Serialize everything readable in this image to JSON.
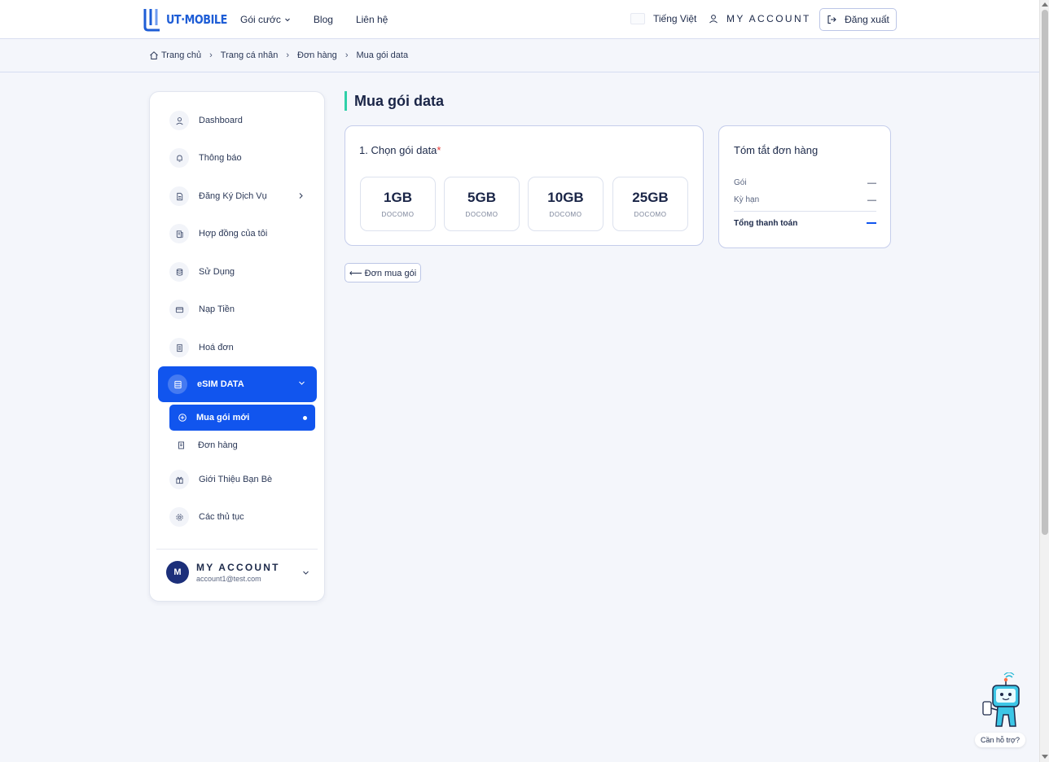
{
  "header": {
    "logo_text": "UT·MOBILE",
    "nav": [
      {
        "label": "Gói cước"
      },
      {
        "label": "Blog"
      },
      {
        "label": "Liên hệ"
      }
    ],
    "language": "Tiếng Việt",
    "account_label": "MY ACCOUNT",
    "logout_label": "Đăng xuất"
  },
  "breadcrumb": [
    "Trang chủ",
    "Trang cá nhân",
    "Đơn hàng",
    "Mua gói data"
  ],
  "sidebar": {
    "items": [
      {
        "label": "Dashboard",
        "icon": "user-icon"
      },
      {
        "label": "Thông báo",
        "icon": "bell-icon"
      },
      {
        "label": "Đăng Ký Dịch Vụ",
        "icon": "document-icon"
      },
      {
        "label": "Hợp đồng của tôi",
        "icon": "contract-icon"
      },
      {
        "label": "Sử Dụng",
        "icon": "database-icon"
      },
      {
        "label": "Nạp Tiền",
        "icon": "card-icon"
      },
      {
        "label": "Hoá đơn",
        "icon": "invoice-icon"
      },
      {
        "label": "eSIM DATA",
        "icon": "sim-icon"
      },
      {
        "label": "Giới Thiệu Bạn Bè",
        "icon": "gift-icon"
      },
      {
        "label": "Các thủ tục",
        "icon": "gear-icon"
      }
    ],
    "sub_items": [
      {
        "label": "Mua gói mới"
      },
      {
        "label": "Đơn hàng"
      }
    ],
    "account": {
      "initial": "M",
      "name": "MY ACCOUNT",
      "email": "account1@test.com"
    }
  },
  "main": {
    "title": "Mua gói data",
    "select_title": "1. Chọn gói data",
    "required_mark": "*",
    "packages": [
      {
        "size": "1GB",
        "operator": "DOCOMO"
      },
      {
        "size": "5GB",
        "operator": "DOCOMO"
      },
      {
        "size": "10GB",
        "operator": "DOCOMO"
      },
      {
        "size": "25GB",
        "operator": "DOCOMO"
      }
    ],
    "back_button": "⟵ Đơn mua gói"
  },
  "summary": {
    "title": "Tóm tắt đơn hàng",
    "rows": [
      {
        "label": "Gói",
        "value": "—"
      },
      {
        "label": "Kỳ hạn",
        "value": "—"
      }
    ],
    "total_label": "Tổng thanh toán"
  },
  "help": {
    "label": "Cần hỗ trợ?"
  },
  "colors": {
    "accent": "#1155ee",
    "title_bar": "#2fd0a8",
    "brand": "#1e5dd6"
  }
}
